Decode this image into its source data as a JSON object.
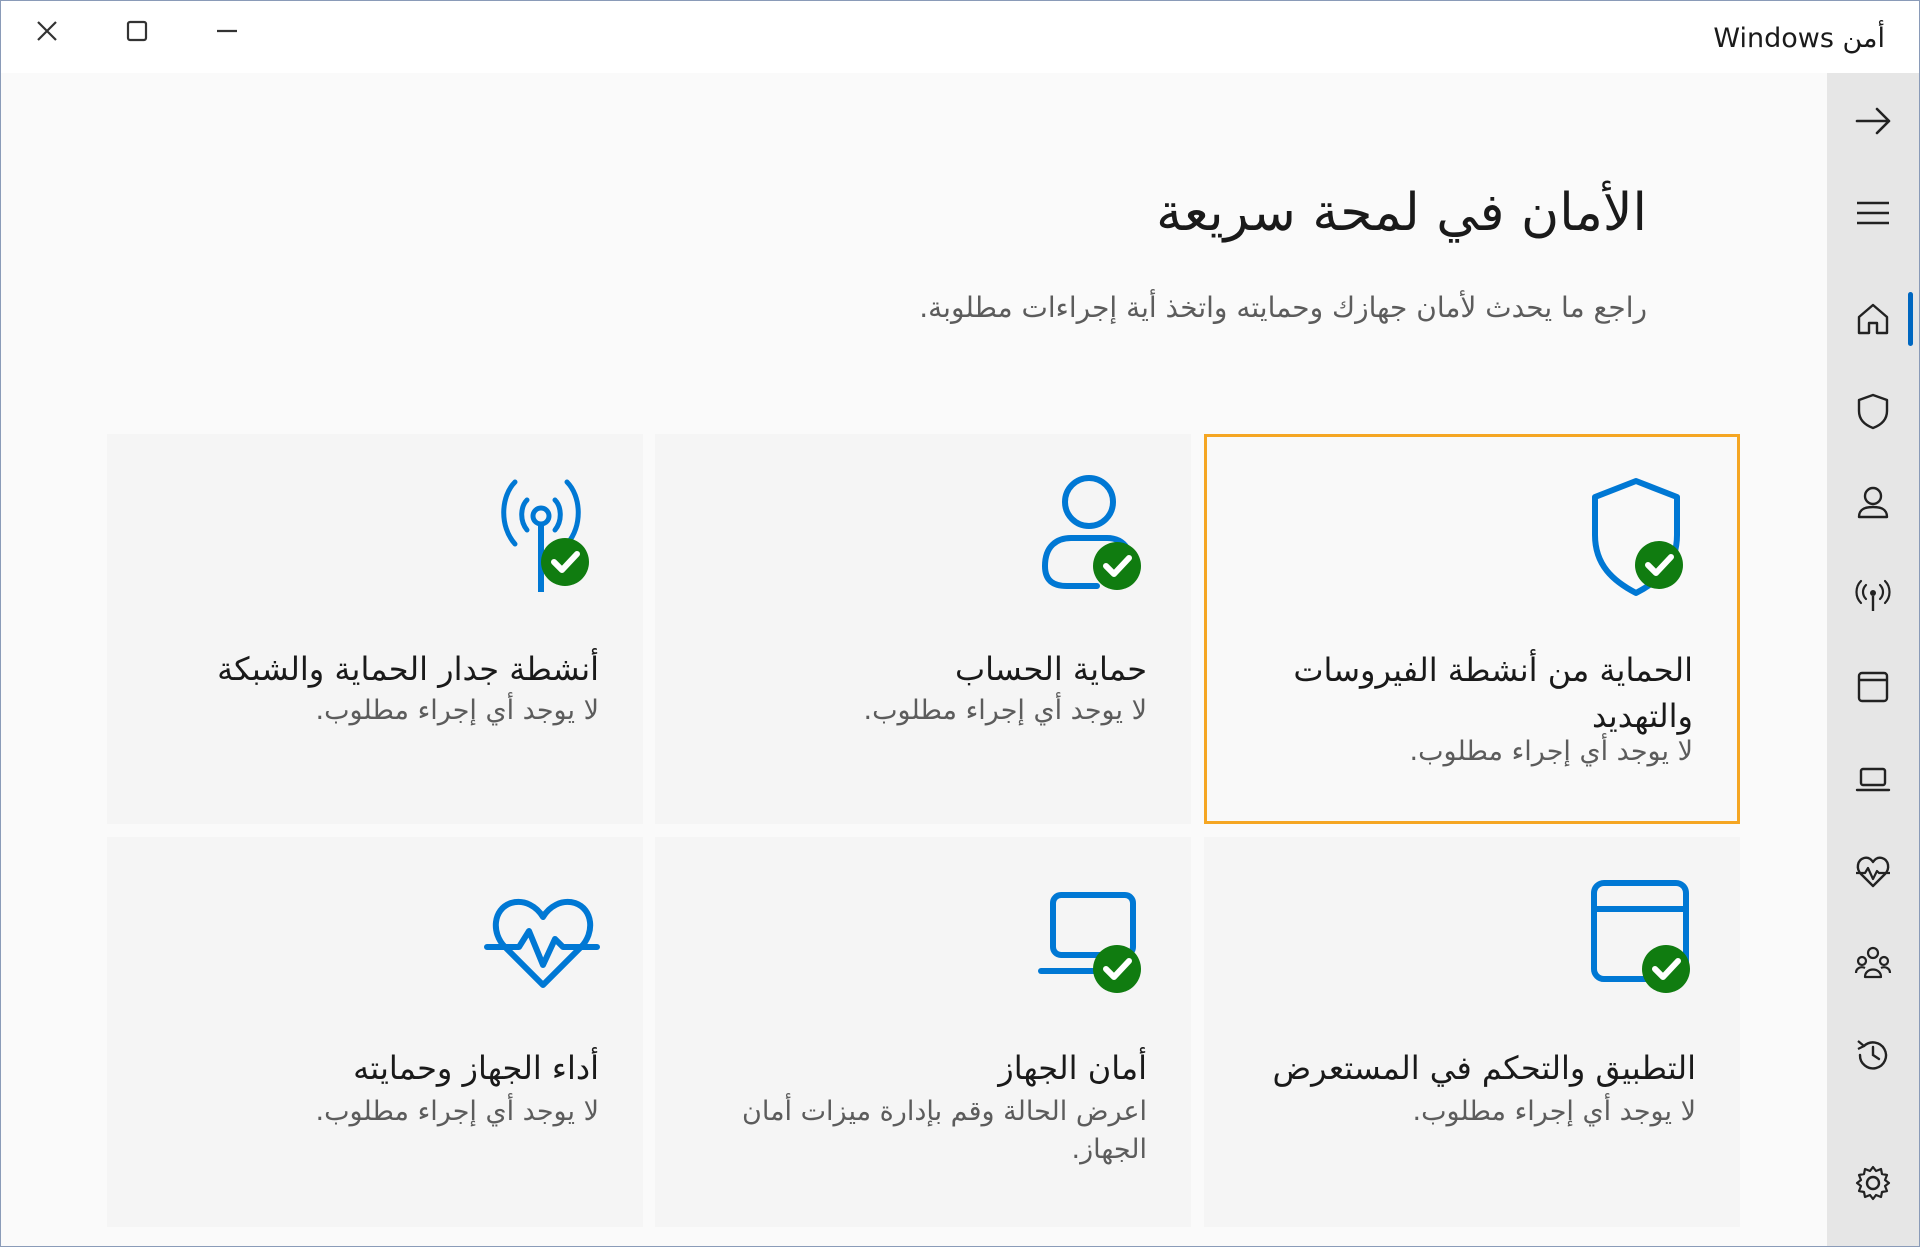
{
  "window": {
    "title": "أمن Windows"
  },
  "caption": {
    "close": "close",
    "maximize": "maximize",
    "minimize": "minimize"
  },
  "nav": {
    "items": [
      {
        "icon": "back-arrow-icon"
      },
      {
        "icon": "hamburger-menu-icon"
      },
      {
        "icon": "home-icon",
        "active": true
      },
      {
        "icon": "shield-icon"
      },
      {
        "icon": "person-icon"
      },
      {
        "icon": "wireless-antenna-icon"
      },
      {
        "icon": "app-browser-icon"
      },
      {
        "icon": "laptop-icon"
      },
      {
        "icon": "heart-pulse-icon"
      },
      {
        "icon": "family-icon"
      },
      {
        "icon": "history-icon"
      },
      {
        "icon": "settings-gear-icon"
      }
    ]
  },
  "main": {
    "title": "الأمان في لمحة سريعة",
    "subtitle": "راجع ما يحدث لأمان جهازك وحمايته واتخذ أية إجراءات مطلوبة.",
    "tiles": [
      {
        "title": "الحماية من أنشطة الفيروسات والتهديد",
        "status": "لا يوجد أي إجراء مطلوب.",
        "icon": "shield-check-icon"
      },
      {
        "title": "حماية الحساب",
        "status": "لا يوجد أي إجراء مطلوب.",
        "icon": "account-check-icon"
      },
      {
        "title": "أنشطة جدار الحماية والشبكة",
        "status": "لا يوجد أي إجراء مطلوب.",
        "icon": "antenna-check-icon"
      },
      {
        "title": "التطبيق والتحكم في المستعرض",
        "status": "لا يوجد أي إجراء مطلوب.",
        "icon": "browser-check-icon"
      },
      {
        "title": "أمان الجهاز",
        "status": "اعرض الحالة وقم بإدارة ميزات أمان الجهاز.",
        "icon": "laptop-check-icon"
      },
      {
        "title": "أداء الجهاز وحمايته",
        "status": "لا يوجد أي إجراء مطلوب.",
        "icon": "heart-pulse-icon"
      }
    ]
  },
  "colors": {
    "accent": "#0067c0",
    "icon_blue": "#0078d4",
    "ok_green": "#107c10",
    "focus": "#f5a623"
  }
}
